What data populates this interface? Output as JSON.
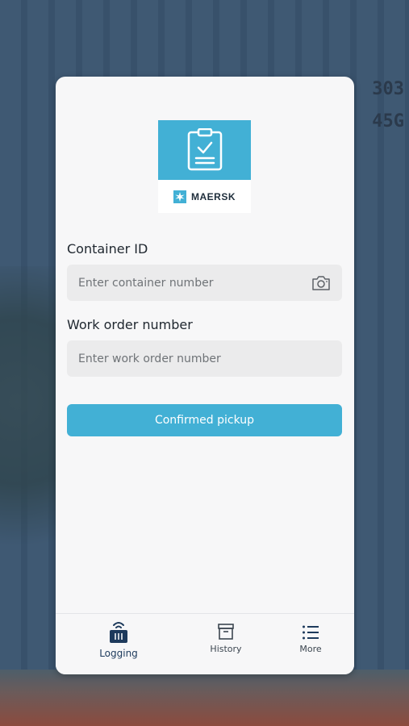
{
  "background": {
    "container_codes": [
      "303",
      "45G"
    ]
  },
  "logo": {
    "brand": "MAERSK",
    "icon": "clipboard-check-icon"
  },
  "form": {
    "container_label": "Container ID",
    "container_placeholder": "Enter container number",
    "camera_icon": "camera-icon",
    "work_order_label": "Work order number",
    "work_order_placeholder": "Enter work order number",
    "submit_label": "Confirmed pickup"
  },
  "tabs": [
    {
      "label": "Logging",
      "icon": "logging-icon",
      "active": true
    },
    {
      "label": "History",
      "icon": "archive-icon",
      "active": false
    },
    {
      "label": "More",
      "icon": "list-icon",
      "active": false
    }
  ],
  "colors": {
    "accent": "#42b0d5",
    "active_tab": "#1d3a5c"
  }
}
